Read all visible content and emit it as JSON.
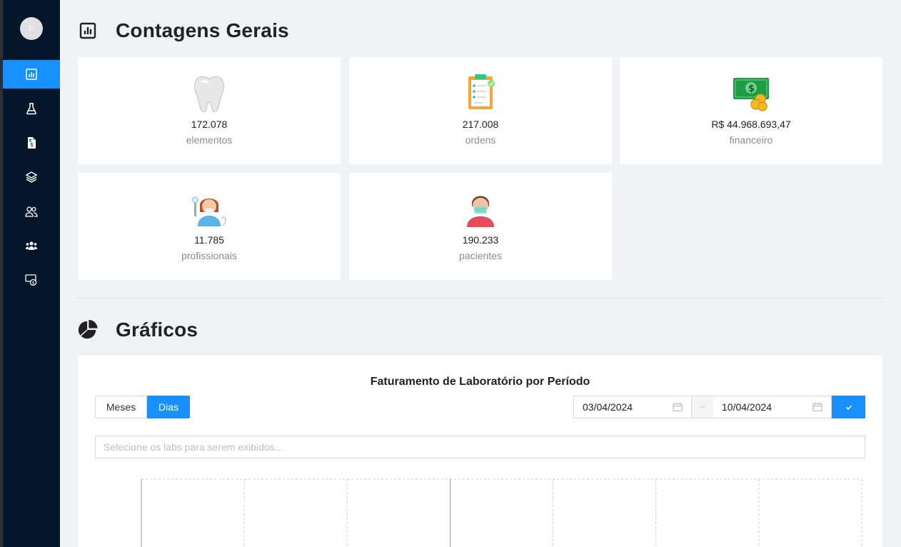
{
  "sidebar": {
    "avatar_initial": "F",
    "items": [
      {
        "name": "dashboard",
        "icon": "bar-chart-icon",
        "active": true
      },
      {
        "name": "laboratorio",
        "icon": "flask-icon",
        "active": false
      },
      {
        "name": "financeiro",
        "icon": "invoice-dollar-icon",
        "active": false
      },
      {
        "name": "elementos",
        "icon": "layers-icon",
        "active": false
      },
      {
        "name": "profissionais",
        "icon": "users-icon",
        "active": false
      },
      {
        "name": "equipes",
        "icon": "team-icon",
        "active": false
      },
      {
        "name": "pagamentos",
        "icon": "money-exchange-icon",
        "active": false
      }
    ]
  },
  "counts": {
    "title": "Contagens Gerais",
    "cards": [
      {
        "icon": "tooth-icon",
        "value": "172.078",
        "label": "elementos"
      },
      {
        "icon": "clipboard-icon",
        "value": "217.008",
        "label": "ordens"
      },
      {
        "icon": "money-coins-icon",
        "value": "R$ 44.968.693,47",
        "label": "financeiro"
      },
      {
        "icon": "dentist-icon",
        "value": "11.785",
        "label": "profissionais"
      },
      {
        "icon": "patient-mask-icon",
        "value": "190.233",
        "label": "pacientes"
      }
    ]
  },
  "charts": {
    "title": "Gráficos",
    "panel_title": "Faturamento de Laboratório por Período",
    "toggle": {
      "months": "Meses",
      "days": "Dias",
      "selected": "Dias"
    },
    "date_range": {
      "start": "03/04/2024",
      "separator": "~",
      "end": "10/04/2024"
    },
    "lab_select_placeholder": "Selecione os labs para serem exibidos..."
  },
  "colors": {
    "sidebar_bg": "#06162b",
    "accent": "#1890ff",
    "page_bg": "#f0f2f5"
  },
  "chart_data": {
    "type": "line",
    "title": "Faturamento de Laboratório por Período",
    "series": [],
    "grid": true
  }
}
